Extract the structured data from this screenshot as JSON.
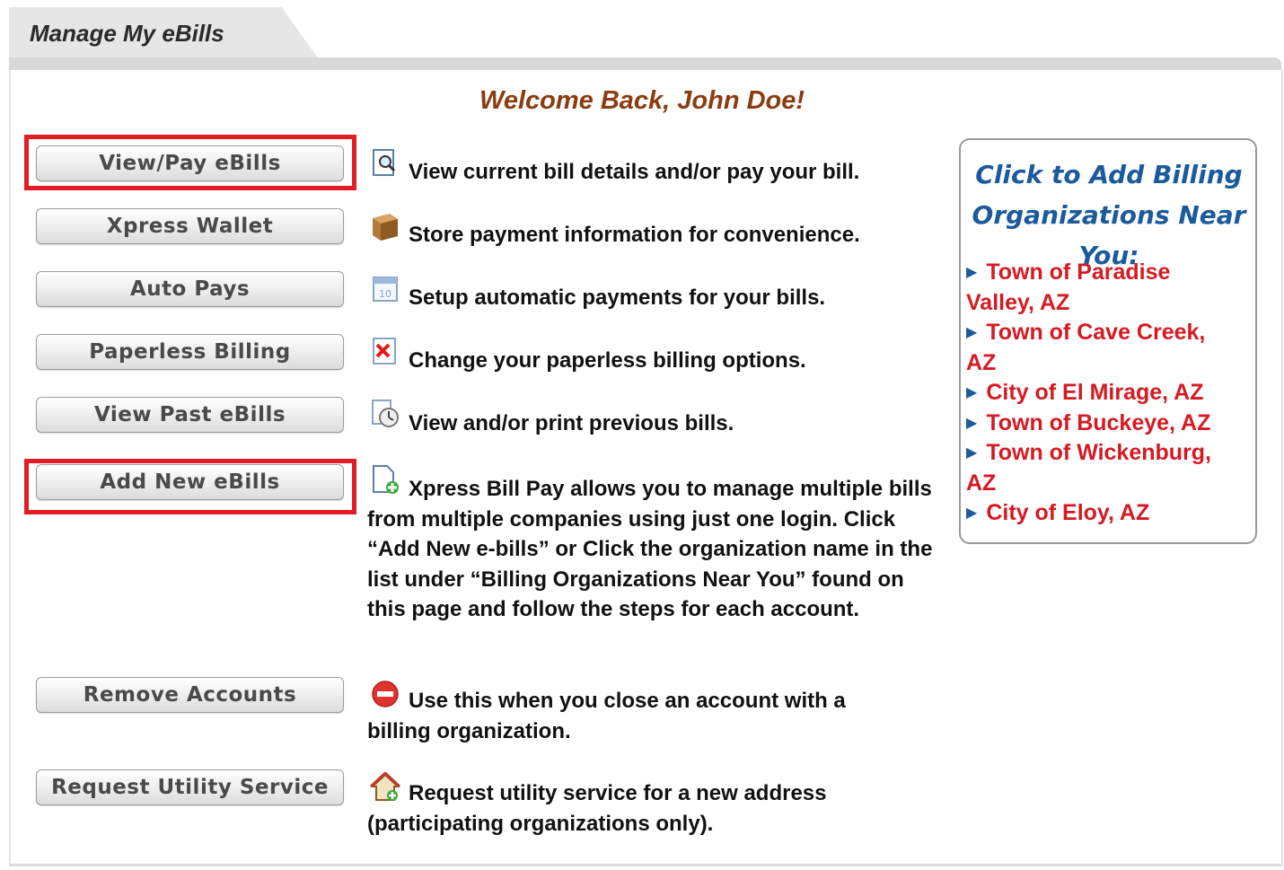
{
  "tab": {
    "title": "Manage My eBills"
  },
  "welcome": "Welcome Back, John Doe!",
  "actions": [
    {
      "label": "View/Pay eBills",
      "icon": "magnifier-document-icon",
      "description": "View current bill details and/or pay your bill.",
      "highlighted": true
    },
    {
      "label": "Xpress Wallet",
      "icon": "wallet-icon",
      "description": "Store payment information for convenience.",
      "highlighted": false
    },
    {
      "label": "Auto Pays",
      "icon": "calendar-icon",
      "description": "Setup automatic payments for your bills.",
      "highlighted": false
    },
    {
      "label": "Paperless Billing",
      "icon": "red-x-icon",
      "description": "Change your paperless billing options.",
      "highlighted": false
    },
    {
      "label": "View Past eBills",
      "icon": "clock-document-icon",
      "description": "View and/or print previous bills.",
      "highlighted": false
    },
    {
      "label": "Add New eBills",
      "icon": "add-document-icon",
      "description": "Xpress Bill Pay allows you to manage multiple bills from multiple companies using just one login. Click “Add New e-bills” or Click the organization name in the list under “Billing Organizations Near You” found on this page and follow the steps for each account.",
      "highlighted": true
    },
    {
      "label": "Remove Accounts",
      "icon": "remove-icon",
      "description": "Use this when you close an account with a billing organization.",
      "highlighted": false
    },
    {
      "label": "Request Utility Service",
      "icon": "house-add-icon",
      "description": "Request utility service for a new address (participating organizations only).",
      "highlighted": false
    }
  ],
  "sidebar": {
    "title": "Click to Add Billing Organizations Near You:",
    "organizations": [
      "Town of Paradise Valley, AZ",
      "Town of Cave Creek, AZ",
      "City of El Mirage, AZ",
      "Town of Buckeye, AZ",
      "Town of Wickenburg, AZ",
      "City of Eloy, AZ"
    ]
  },
  "colors": {
    "highlight": "#e31c23",
    "welcome": "#8a3d10",
    "sidebar_title": "#1b5a9c",
    "organization_link": "#d51a22"
  }
}
